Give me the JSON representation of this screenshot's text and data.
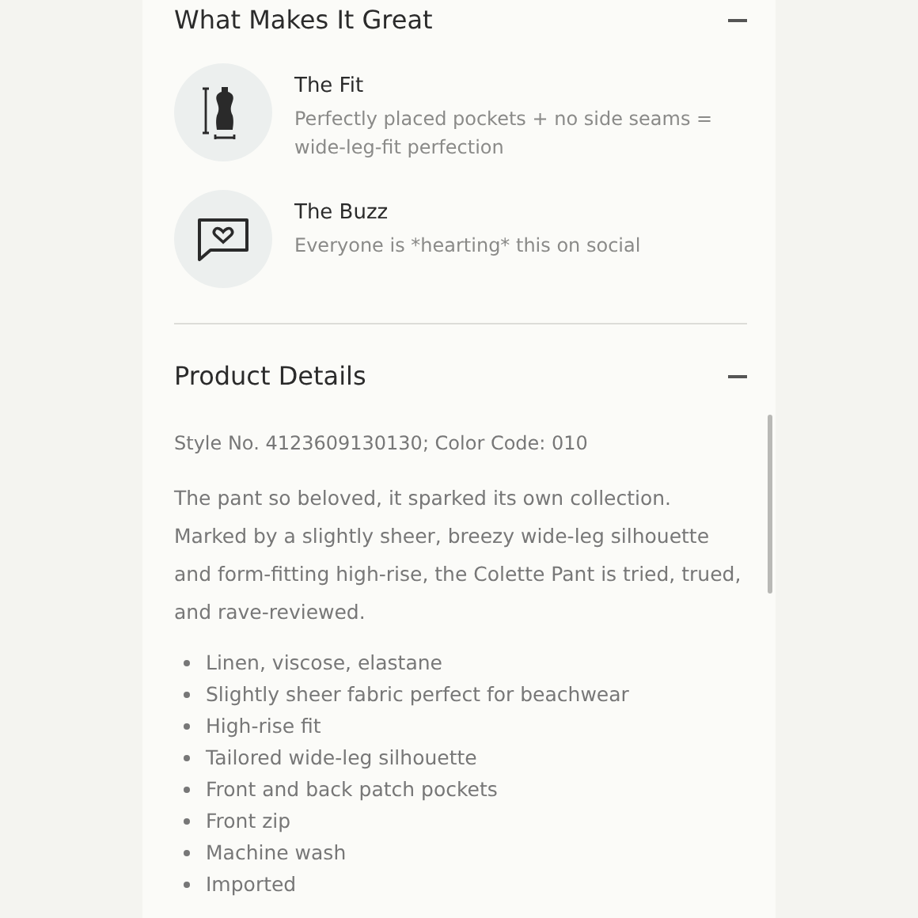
{
  "sections": [
    {
      "title": "What Makes It Great",
      "expanded": true,
      "features": [
        {
          "kind": "fit",
          "title": "The Fit",
          "description": "Perfectly placed pockets + no side seams = wide-leg-fit perfection"
        },
        {
          "kind": "buzz",
          "title": "The Buzz",
          "description": "Everyone is *hearting* this on social"
        }
      ]
    },
    {
      "title": "Product Details",
      "expanded": true,
      "style_line": "Style No. 4123609130130; Color Code: 010",
      "description": "The pant so beloved, it sparked its own collection. Marked by a slightly sheer, breezy wide-leg silhouette and form-fitting high-rise, the Colette Pant is tried, trued, and rave-reviewed.",
      "bullets": [
        "Linen, viscose, elastane",
        "Slightly sheer fabric perfect for beachwear",
        "High-rise fit",
        "Tailored wide-leg silhouette",
        "Front and back patch pockets",
        "Front zip",
        "Machine wash",
        "Imported"
      ]
    }
  ]
}
